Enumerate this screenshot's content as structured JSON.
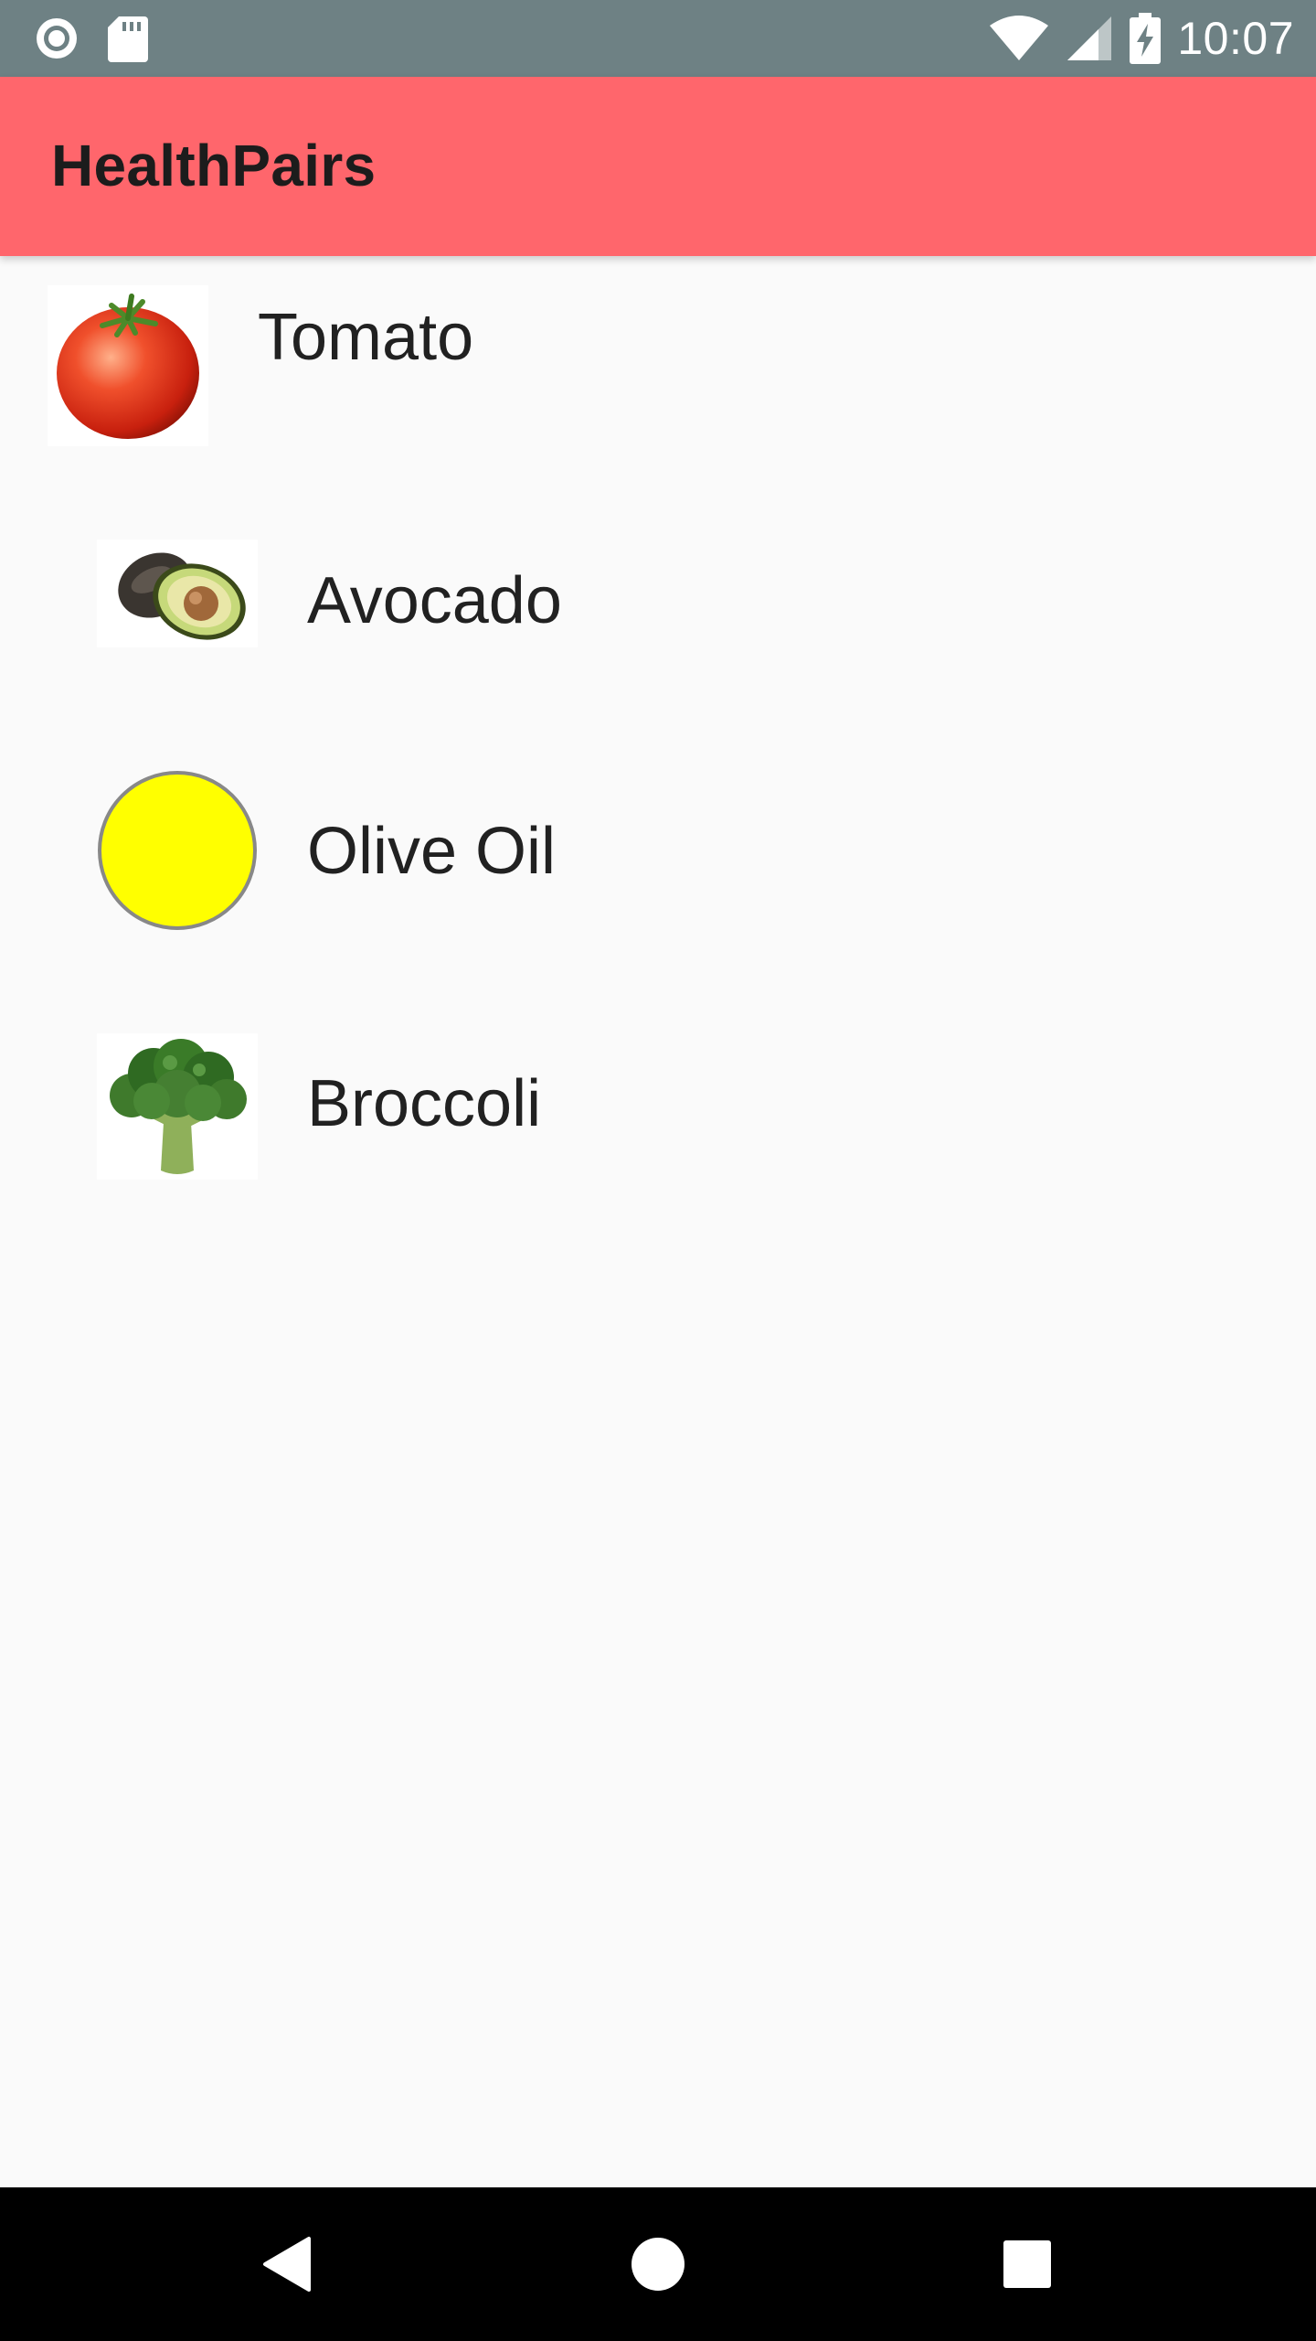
{
  "status_bar": {
    "time": "10:07",
    "icons": [
      "record-icon",
      "sd-card-icon",
      "wifi-icon",
      "cell-signal-icon",
      "battery-charging-icon"
    ]
  },
  "app_bar": {
    "title": "HealthPairs",
    "color": "#ff666c"
  },
  "items": [
    {
      "label": "Tomato",
      "image": "tomato-image"
    },
    {
      "label": "Avocado",
      "image": "avocado-image"
    },
    {
      "label": "Olive Oil",
      "image": "yellow-circle-image",
      "image_color": "#ffff00"
    },
    {
      "label": "Broccoli",
      "image": "broccoli-image"
    }
  ],
  "nav_bar": {
    "buttons": [
      "back-icon",
      "home-icon",
      "recents-icon"
    ]
  }
}
